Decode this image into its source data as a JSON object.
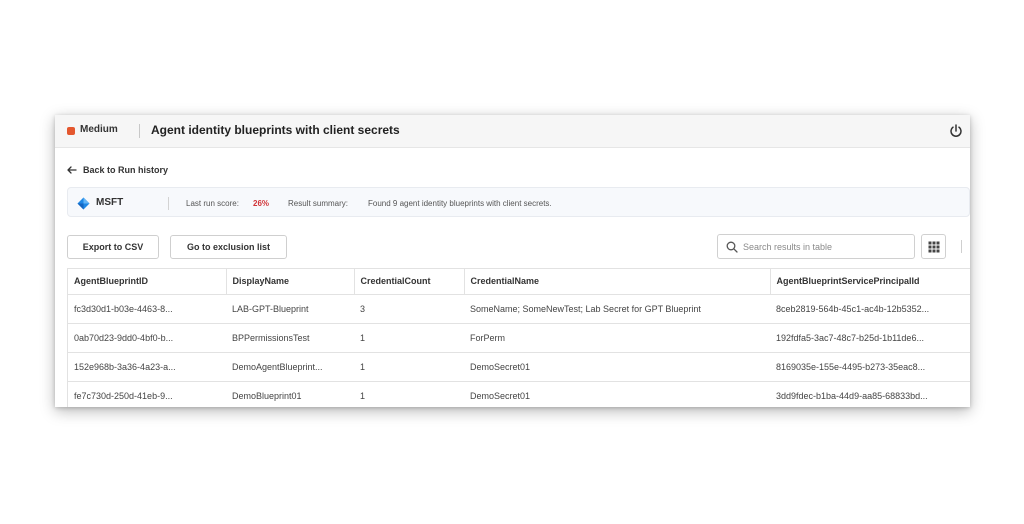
{
  "header": {
    "severity_label": "Medium",
    "severity_color": "#e4572e",
    "title": "Agent identity blueprints with client secrets",
    "power_icon": "power-icon"
  },
  "nav": {
    "back_label": "Back to Run history",
    "back_icon": "arrow-left-icon"
  },
  "summary": {
    "tenant_icon": "msft-diamond-icon",
    "tenant_name": "MSFT",
    "score_label": "Last run score:",
    "score_value": "26%",
    "score_color": "#d13438",
    "result_label": "Result summary:",
    "result_text": "Found 9 agent identity blueprints with client secrets."
  },
  "toolbar": {
    "export_label": "Export to CSV",
    "exclusion_label": "Go to exclusion list",
    "search_placeholder": "Search results in table",
    "search_icon": "search-icon",
    "columns_icon": "columns-icon"
  },
  "table": {
    "columns": [
      "AgentBlueprintID",
      "DisplayName",
      "CredentialCount",
      "CredentialName",
      "AgentBlueprintServicePrincipalId"
    ],
    "rows": [
      [
        "fc3d30d1-b03e-4463-8...",
        "LAB-GPT-Blueprint",
        "3",
        "SomeName; SomeNewTest; Lab Secret for GPT Blueprint",
        "8ceb2819-564b-45c1-ac4b-12b5352..."
      ],
      [
        "0ab70d23-9dd0-4bf0-b...",
        "BPPermissionsTest",
        "1",
        "ForPerm",
        "192fdfa5-3ac7-48c7-b25d-1b11de6..."
      ],
      [
        "152e968b-3a36-4a23-a...",
        "DemoAgentBlueprint...",
        "1",
        "DemoSecret01",
        "8169035e-155e-4495-b273-35eac8..."
      ],
      [
        "fe7c730d-250d-41eb-9...",
        "DemoBlueprint01",
        "1",
        "DemoSecret01",
        "3dd9fdec-b1ba-44d9-aa85-68833bd..."
      ]
    ]
  }
}
